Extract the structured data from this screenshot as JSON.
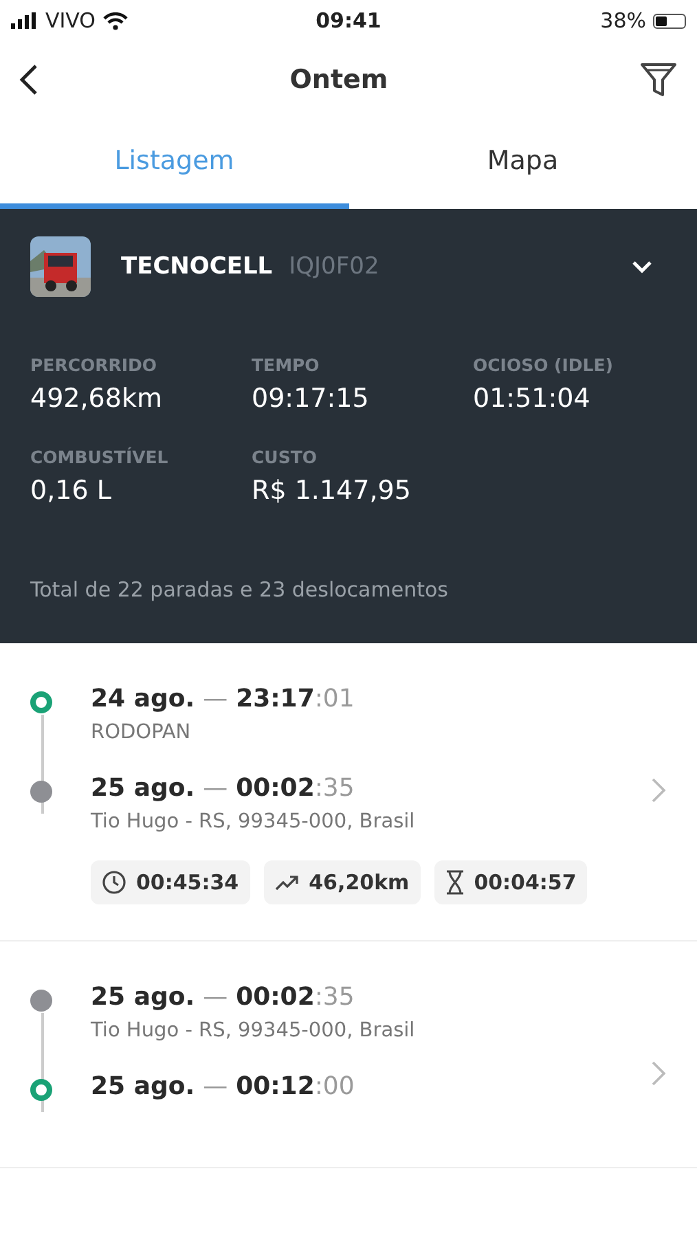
{
  "status_bar": {
    "carrier": "VIVO",
    "time": "09:41",
    "battery": "38%"
  },
  "header": {
    "title": "Ontem"
  },
  "tabs": [
    {
      "label": "Listagem",
      "selected": true
    },
    {
      "label": "Mapa",
      "selected": false
    }
  ],
  "vehicle": {
    "name": "TECNOCELL",
    "plate": "IQJ0F02",
    "expanded": false,
    "stats": [
      {
        "label": "PERCORRIDO",
        "value": "492,68km"
      },
      {
        "label": "TEMPO",
        "value": "09:17:15"
      },
      {
        "label": "OCIOSO (IDLE)",
        "value": "01:51:04"
      },
      {
        "label": "COMBUSTÍVEL",
        "value": "0,16 L"
      },
      {
        "label": "CUSTO",
        "value": "R$ 1.147,95"
      }
    ],
    "summary": "Total de 22 paradas e 23 deslocamentos"
  },
  "trips": [
    {
      "points": [
        {
          "kind": "start",
          "date": "24 ago.",
          "dash": "—",
          "time": "23:17",
          "seconds": ":01",
          "place": "RODOPAN"
        },
        {
          "kind": "stop",
          "date": "25 ago.",
          "dash": "—",
          "time": "00:02",
          "seconds": ":35",
          "place": "Tio Hugo - RS, 99345-000, Brasil"
        }
      ],
      "chips": [
        {
          "kind": "duration",
          "value": "00:45:34"
        },
        {
          "kind": "distance",
          "value": "46,20km"
        },
        {
          "kind": "idle",
          "value": "00:04:57"
        }
      ]
    },
    {
      "points": [
        {
          "kind": "stop",
          "date": "25 ago.",
          "dash": "—",
          "time": "00:02",
          "seconds": ":35",
          "place": "Tio Hugo - RS, 99345-000, Brasil"
        },
        {
          "kind": "start",
          "date": "25 ago.",
          "dash": "—",
          "time": "00:12",
          "seconds": ":00"
        }
      ]
    }
  ]
}
